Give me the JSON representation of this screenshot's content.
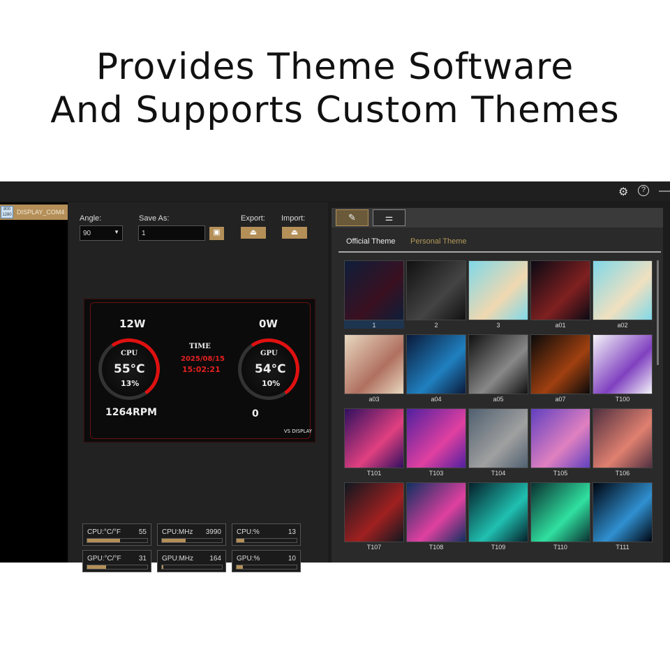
{
  "headline": {
    "line1": "Provides Theme Software",
    "line2": "And Supports Custom Themes"
  },
  "titlebar": {
    "settings": "⚙",
    "help": "?",
    "minimize": "—"
  },
  "sidebar": {
    "device": "DISPLAY_COM4",
    "device_icon_text": "800 1280"
  },
  "controls": {
    "angle_label": "Angle:",
    "angle_value": "90",
    "save_as_label": "Save As:",
    "save_as_value": "1",
    "export_label": "Export:",
    "import_label": "Import:"
  },
  "preview": {
    "cpu_power": "12W",
    "gpu_power": "0W",
    "cpu_label": "CPU",
    "gpu_label": "GPU",
    "cpu_temp": "55°C",
    "gpu_temp": "54°C",
    "cpu_usage": "13%",
    "gpu_usage": "10%",
    "fan": "1264RPM",
    "gpu_fan": "0",
    "time_label": "TIME",
    "date": "2025/08/15",
    "time": "15:02:21",
    "brand": "VS DISPLAY"
  },
  "stats": [
    {
      "name": "CPU:°C/°F",
      "value": "55",
      "fill": 0.55
    },
    {
      "name": "CPU:MHz",
      "value": "3990",
      "fill": 0.4
    },
    {
      "name": "CPU:%",
      "value": "13",
      "fill": 0.13
    },
    {
      "name": "GPU:°C/°F",
      "value": "31",
      "fill": 0.31
    },
    {
      "name": "GPU:MHz",
      "value": "164",
      "fill": 0.02
    },
    {
      "name": "GPU:%",
      "value": "10",
      "fill": 0.1
    }
  ],
  "theme_tabs": {
    "official": "Official Theme",
    "personal": "Personal Theme"
  },
  "themes": [
    {
      "name": "1",
      "c1": "#0e1e3a",
      "c2": "#3a1020"
    },
    {
      "name": "2",
      "c1": "#111",
      "c2": "#444"
    },
    {
      "name": "3",
      "c1": "#7fd8e8",
      "c2": "#f0d8b0"
    },
    {
      "name": "a01",
      "c1": "#0a0a14",
      "c2": "#802020"
    },
    {
      "name": "a02",
      "c1": "#7fd8e8",
      "c2": "#f0e0c0"
    },
    {
      "name": "a03",
      "c1": "#e8d8c0",
      "c2": "#b07060"
    },
    {
      "name": "a04",
      "c1": "#0a1a3a",
      "c2": "#2080c0"
    },
    {
      "name": "a05",
      "c1": "#111",
      "c2": "#888"
    },
    {
      "name": "a07",
      "c1": "#0a0a0a",
      "c2": "#a04010"
    },
    {
      "name": "T100",
      "c1": "#f4f4f8",
      "c2": "#8040c0"
    },
    {
      "name": "T101",
      "c1": "#301060",
      "c2": "#e04080"
    },
    {
      "name": "T103",
      "c1": "#5020a0",
      "c2": "#e040a0"
    },
    {
      "name": "T104",
      "c1": "#506070",
      "c2": "#a0a0a0"
    },
    {
      "name": "T105",
      "c1": "#6040c0",
      "c2": "#e080c0"
    },
    {
      "name": "T106",
      "c1": "#503040",
      "c2": "#e08070"
    },
    {
      "name": "T107",
      "c1": "#101820",
      "c2": "#a02020"
    },
    {
      "name": "T108",
      "c1": "#103060",
      "c2": "#e040a0"
    },
    {
      "name": "T109",
      "c1": "#05202a",
      "c2": "#20c0b0"
    },
    {
      "name": "T110",
      "c1": "#0a3030",
      "c2": "#30e0a0"
    },
    {
      "name": "T111",
      "c1": "#000510",
      "c2": "#3090d0"
    }
  ],
  "colors": {
    "accent": "#b48f58"
  }
}
